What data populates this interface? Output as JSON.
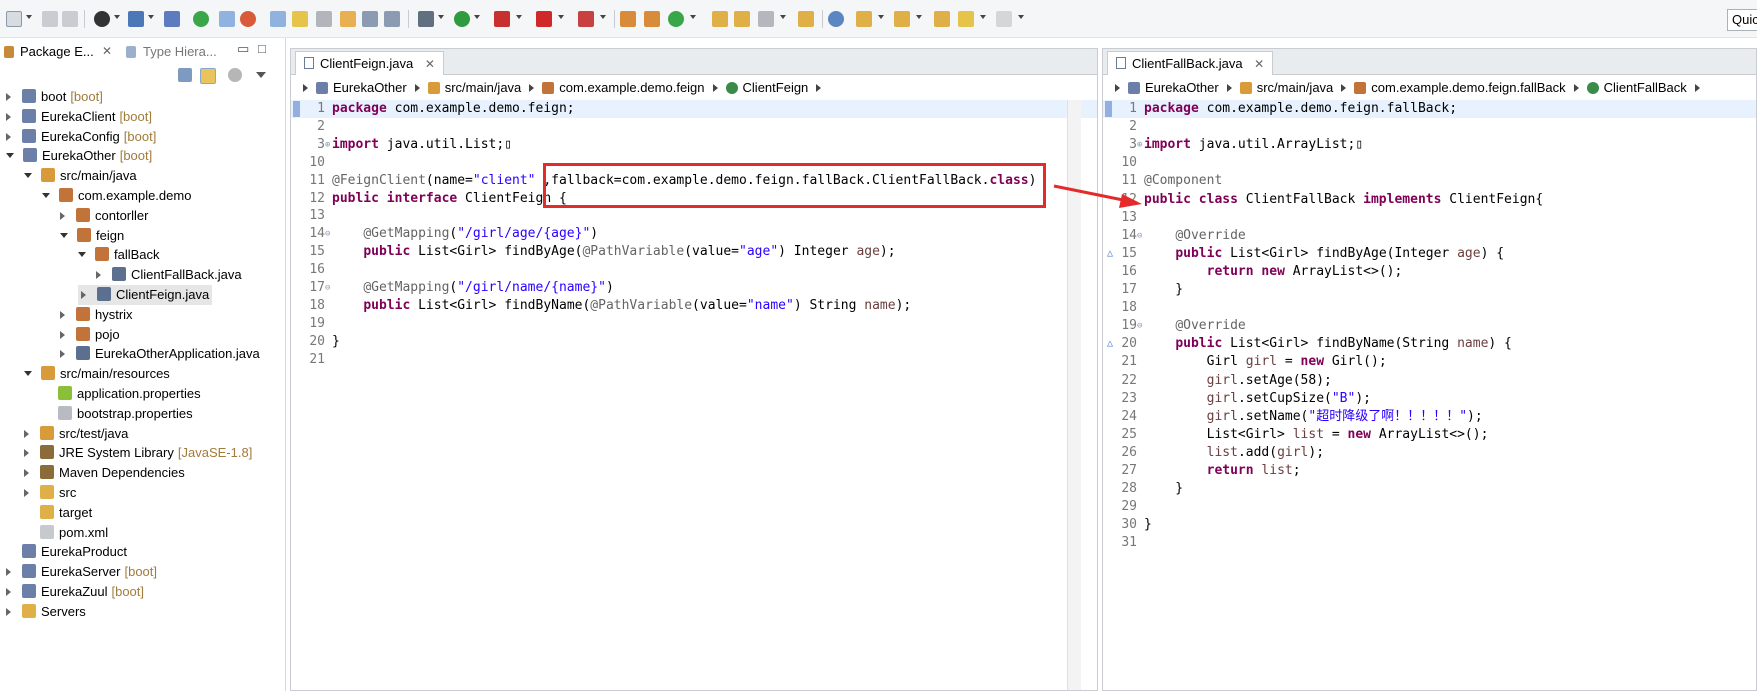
{
  "toolbar": {
    "quick_access": "Quic"
  },
  "package_explorer": {
    "tab_active": "Package E...",
    "tab_inactive": "Type Hiera...",
    "tree": [
      {
        "label": "boot",
        "decor": "[boot]",
        "depth": 0,
        "state": "closed",
        "icon": "project-icon"
      },
      {
        "label": "EurekaClient",
        "decor": "[boot]",
        "depth": 0,
        "state": "closed",
        "icon": "project-icon"
      },
      {
        "label": "EurekaConfig",
        "decor": "[boot]",
        "depth": 0,
        "state": "closed",
        "icon": "project-icon"
      },
      {
        "label": "EurekaOther",
        "decor": "[boot]",
        "depth": 0,
        "state": "open",
        "icon": "project-icon"
      },
      {
        "label": "src/main/java",
        "decor": "",
        "depth": 1,
        "state": "open",
        "icon": "source-folder-icon"
      },
      {
        "label": "com.example.demo",
        "decor": "",
        "depth": 2,
        "state": "open",
        "icon": "package-icon"
      },
      {
        "label": "contorller",
        "decor": "",
        "depth": 3,
        "state": "closed",
        "icon": "package-icon"
      },
      {
        "label": "feign",
        "decor": "",
        "depth": 3,
        "state": "open",
        "icon": "package-icon"
      },
      {
        "label": "fallBack",
        "decor": "",
        "depth": 4,
        "state": "open",
        "icon": "package-icon"
      },
      {
        "label": "ClientFallBack.java",
        "decor": "",
        "depth": 5,
        "state": "closed",
        "icon": "java-file-icon"
      },
      {
        "label": "ClientFeign.java",
        "decor": "",
        "depth": 4,
        "state": "closed",
        "icon": "java-file-icon",
        "selected": true
      },
      {
        "label": "hystrix",
        "decor": "",
        "depth": 3,
        "state": "closed",
        "icon": "package-icon"
      },
      {
        "label": "pojo",
        "decor": "",
        "depth": 3,
        "state": "closed",
        "icon": "package-icon"
      },
      {
        "label": "EurekaOtherApplication.java",
        "decor": "",
        "depth": 3,
        "state": "closed",
        "icon": "java-file-icon"
      },
      {
        "label": "src/main/resources",
        "decor": "",
        "depth": 1,
        "state": "open",
        "icon": "source-folder-icon"
      },
      {
        "label": "application.properties",
        "decor": "",
        "depth": 2,
        "state": "none",
        "icon": "properties-icon"
      },
      {
        "label": "bootstrap.properties",
        "decor": "",
        "depth": 2,
        "state": "none",
        "icon": "file-icon"
      },
      {
        "label": "src/test/java",
        "decor": "",
        "depth": 1,
        "state": "closed",
        "icon": "source-folder-icon"
      },
      {
        "label": "JRE System Library",
        "decor": "[JavaSE-1.8]",
        "depth": 1,
        "state": "closed",
        "icon": "library-icon"
      },
      {
        "label": "Maven Dependencies",
        "decor": "",
        "depth": 1,
        "state": "closed",
        "icon": "library-icon"
      },
      {
        "label": "src",
        "decor": "",
        "depth": 1,
        "state": "closed",
        "icon": "folder-icon"
      },
      {
        "label": "target",
        "decor": "",
        "depth": 1,
        "state": "none",
        "icon": "folder-icon"
      },
      {
        "label": "pom.xml",
        "decor": "",
        "depth": 1,
        "state": "none",
        "icon": "xml-file-icon"
      },
      {
        "label": "EurekaProduct",
        "decor": "",
        "depth": 0,
        "state": "none",
        "icon": "project-icon"
      },
      {
        "label": "EurekaServer",
        "decor": "[boot]",
        "depth": 0,
        "state": "closed",
        "icon": "project-icon"
      },
      {
        "label": "EurekaZuul",
        "decor": "[boot]",
        "depth": 0,
        "state": "closed",
        "icon": "project-icon"
      },
      {
        "label": "Servers",
        "decor": "",
        "depth": 0,
        "state": "closed",
        "icon": "folder-icon"
      }
    ]
  },
  "editor_left": {
    "tab": "ClientFeign.java",
    "breadcrumbs": [
      "EurekaOther",
      "src/main/java",
      "com.example.demo.feign",
      "ClientFeign"
    ],
    "lines": [
      {
        "n": "1",
        "fold": "",
        "html": "<span class='kw'>package</span> com.example.demo.feign;",
        "current": true
      },
      {
        "n": "2",
        "fold": "",
        "html": ""
      },
      {
        "n": "3",
        "fold": "⊕",
        "html": "<span class='kw'>import</span> java.util.List;▯"
      },
      {
        "n": "10",
        "fold": "",
        "html": ""
      },
      {
        "n": "11",
        "fold": "",
        "html": "<span class='ann'>@FeignClient</span>(name=<span class='str'>\"client\"</span> ,fallback=com.example.demo.feign.fallBack.ClientFallBack.<span class='kw'>class</span>)"
      },
      {
        "n": "12",
        "fold": "",
        "html": "<span class='kw'>public interface</span> ClientFeign {"
      },
      {
        "n": "13",
        "fold": "",
        "html": ""
      },
      {
        "n": "14",
        "fold": "⊖",
        "html": "    <span class='ann'>@GetMapping</span>(<span class='str'>\"/girl/age/{age}\"</span>)"
      },
      {
        "n": "15",
        "fold": "",
        "html": "    <span class='kw'>public</span> List&lt;Girl&gt; findByAge(<span class='ann'>@PathVariable</span>(value=<span class='str'>\"age\"</span>) Integer <span class='var'>age</span>);"
      },
      {
        "n": "16",
        "fold": "",
        "html": ""
      },
      {
        "n": "17",
        "fold": "⊖",
        "html": "    <span class='ann'>@GetMapping</span>(<span class='str'>\"/girl/name/{name}\"</span>)"
      },
      {
        "n": "18",
        "fold": "",
        "html": "    <span class='kw'>public</span> List&lt;Girl&gt; findByName(<span class='ann'>@PathVariable</span>(value=<span class='str'>\"name\"</span>) String <span class='var'>name</span>);"
      },
      {
        "n": "19",
        "fold": "",
        "html": ""
      },
      {
        "n": "20",
        "fold": "",
        "html": "}"
      },
      {
        "n": "21",
        "fold": "",
        "html": ""
      }
    ]
  },
  "editor_right": {
    "tab": "ClientFallBack.java",
    "breadcrumbs": [
      "EurekaOther",
      "src/main/java",
      "com.example.demo.feign.fallBack",
      "ClientFallBack"
    ],
    "lines": [
      {
        "n": "1",
        "fold": "",
        "html": "<span class='kw'>package</span> com.example.demo.feign.fallBack;",
        "current": true
      },
      {
        "n": "2",
        "fold": "",
        "html": ""
      },
      {
        "n": "3",
        "fold": "⊕",
        "html": "<span class='kw'>import</span> java.util.ArrayList;▯"
      },
      {
        "n": "10",
        "fold": "",
        "html": ""
      },
      {
        "n": "11",
        "fold": "",
        "html": "<span class='ann'>@Component</span>"
      },
      {
        "n": "12",
        "fold": "",
        "html": "<span class='kw'>public class</span> ClientFallBack <span class='kw'>implements</span> ClientFeign{"
      },
      {
        "n": "13",
        "fold": "",
        "html": ""
      },
      {
        "n": "14",
        "fold": "⊖",
        "html": "    <span class='ann'>@Override</span>"
      },
      {
        "n": "15",
        "fold": "",
        "ov": true,
        "html": "    <span class='kw'>public</span> List&lt;Girl&gt; findByAge(Integer <span class='var'>age</span>) {"
      },
      {
        "n": "16",
        "fold": "",
        "html": "        <span class='kw'>return new</span> ArrayList&lt;&gt;();"
      },
      {
        "n": "17",
        "fold": "",
        "html": "    }"
      },
      {
        "n": "18",
        "fold": "",
        "html": ""
      },
      {
        "n": "19",
        "fold": "⊖",
        "html": "    <span class='ann'>@Override</span>"
      },
      {
        "n": "20",
        "fold": "",
        "ov": true,
        "html": "    <span class='kw'>public</span> List&lt;Girl&gt; findByName(String <span class='var'>name</span>) {"
      },
      {
        "n": "21",
        "fold": "",
        "html": "        Girl <span class='var'>girl</span> = <span class='kw'>new</span> Girl();"
      },
      {
        "n": "22",
        "fold": "",
        "html": "        <span class='var'>girl</span>.setAge(58);"
      },
      {
        "n": "23",
        "fold": "",
        "html": "        <span class='var'>girl</span>.setCupSize(<span class='str'>\"B\"</span>);"
      },
      {
        "n": "24",
        "fold": "",
        "html": "        <span class='var'>girl</span>.setName(<span class='str'>\"超时降级了啊！！！！！\"</span>);"
      },
      {
        "n": "25",
        "fold": "",
        "html": "        List&lt;Girl&gt; <span class='var'>list</span> = <span class='kw'>new</span> ArrayList&lt;&gt;();"
      },
      {
        "n": "26",
        "fold": "",
        "html": "        <span class='var'>list</span>.add(<span class='var'>girl</span>);"
      },
      {
        "n": "27",
        "fold": "",
        "html": "        <span class='kw'>return</span> <span class='var'>list</span>;"
      },
      {
        "n": "28",
        "fold": "",
        "html": "    }"
      },
      {
        "n": "29",
        "fold": "",
        "html": ""
      },
      {
        "n": "30",
        "fold": "",
        "html": "}"
      },
      {
        "n": "31",
        "fold": "",
        "html": ""
      }
    ]
  },
  "colors": {
    "keyword": "#7f0055",
    "string": "#2a00ff",
    "annotation": "#646464",
    "highlight": "#e32b2b"
  }
}
